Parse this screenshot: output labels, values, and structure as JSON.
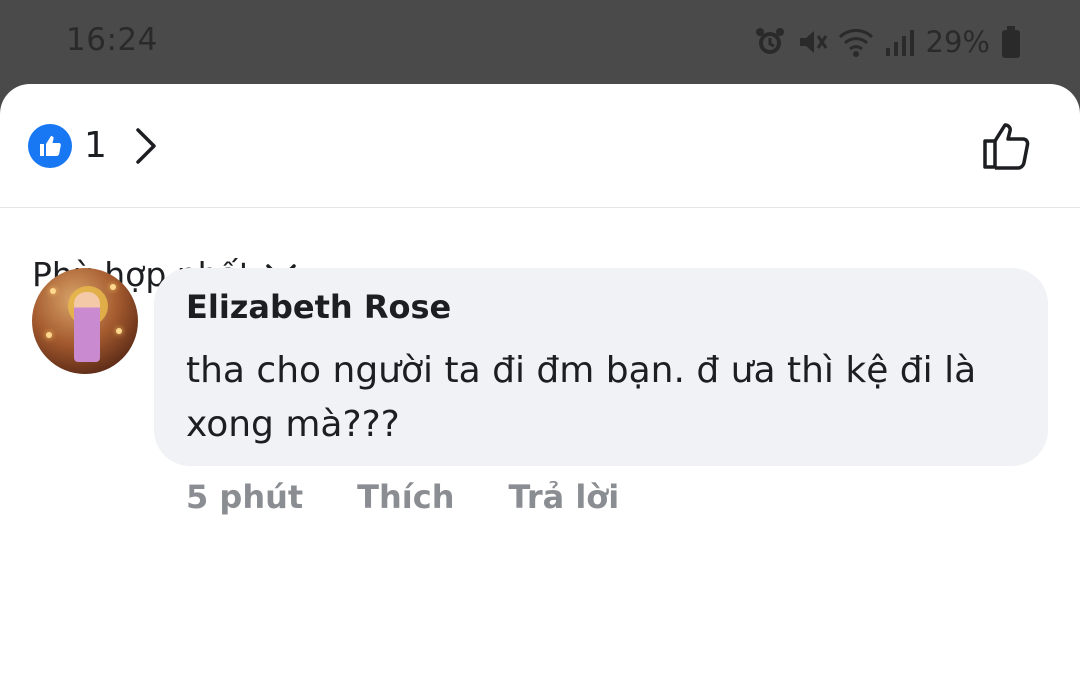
{
  "status_bar": {
    "time": "16:24",
    "battery_percent": "29%",
    "icons": [
      "alarm-icon",
      "mute-icon",
      "wifi-icon",
      "signal-icon",
      "battery-icon"
    ]
  },
  "reactions": {
    "icon": "like-icon",
    "count": "1",
    "accent_color": "#1877f2"
  },
  "sort": {
    "label": "Phù hợp nhất"
  },
  "comment": {
    "author": "Elizabeth Rose",
    "text": "tha cho người ta đi đm bạn. đ ưa thì kệ đi là xong mà???",
    "time": "5 phút",
    "like_label": "Thích",
    "reply_label": "Trả lời"
  }
}
